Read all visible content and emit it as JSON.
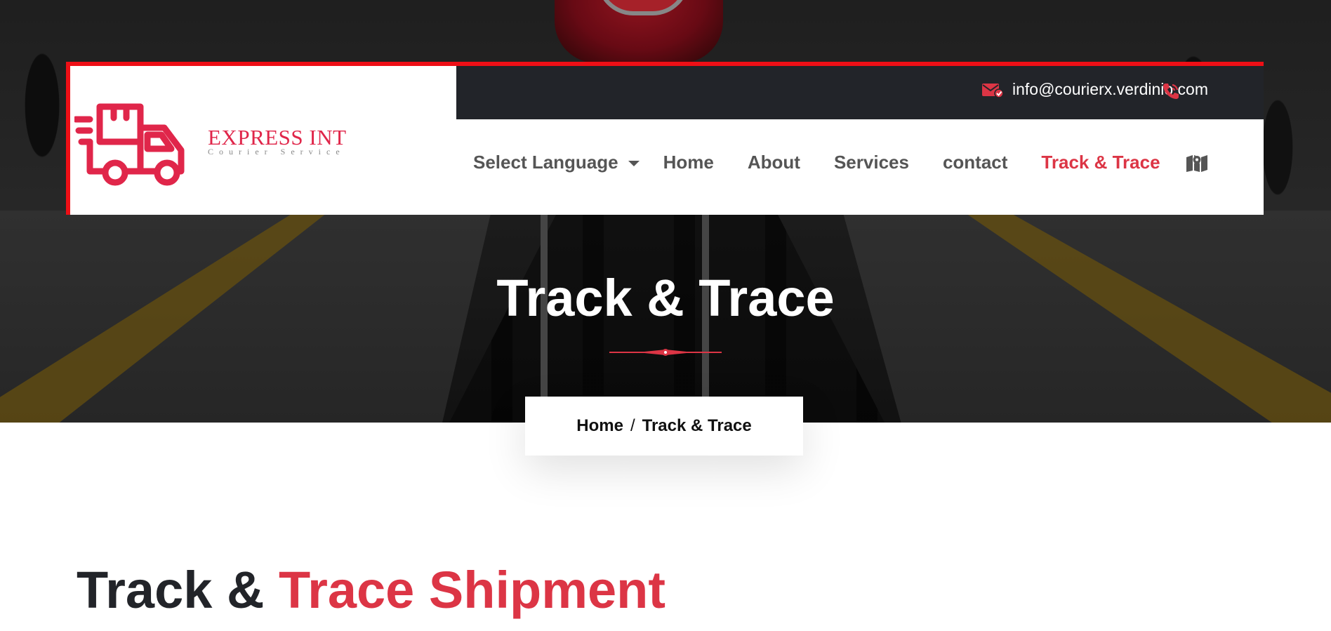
{
  "header": {
    "logo": {
      "brand_name": "EXPRESS INT",
      "tagline": "Courier Service",
      "icon": "delivery-truck-icon"
    },
    "topbar": {
      "email": "info@courierx.verdinio.com",
      "email_icon": "envelope-check-icon",
      "phone_icon": "phone-ringing-icon"
    },
    "nav": {
      "language": "Select Language",
      "items": [
        "Home",
        "About",
        "Services",
        "contact",
        "Track & Trace"
      ],
      "active_item": "Track & Trace",
      "map_icon": "map-marker-icon"
    }
  },
  "hero": {
    "title": "Track & Trace"
  },
  "breadcrumb": {
    "home": "Home",
    "separator": "/",
    "current": "Track & Trace"
  },
  "section": {
    "title_plain": "Track & ",
    "title_accent": "Trace Shipment"
  },
  "colors": {
    "accent": "#dc3545",
    "brand": "#e0264a",
    "border": "#ee0f16",
    "dark": "#222429",
    "nav_text": "#555555"
  }
}
